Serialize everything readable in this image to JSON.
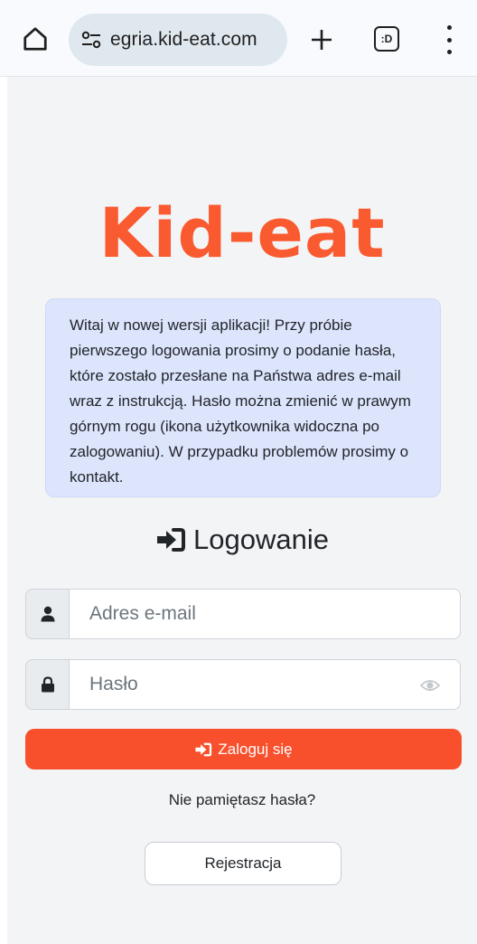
{
  "browser": {
    "url": "egria.kid-eat.com",
    "tabs_label": ":D"
  },
  "logo": {
    "text": "Kid-eat"
  },
  "info": {
    "message": "Witaj w nowej wersji aplikacji! Przy próbie pierwszego logowania prosimy o podanie hasła, które zostało przesłane na Państwa adres e-mail wraz z instrukcją. Hasło można zmienić w prawym górnym rogu (ikona użytkownika widoczna po zalogowaniu). W przypadku problemów prosimy o kontakt."
  },
  "login": {
    "heading": "Logowanie",
    "email_placeholder": "Adres e-mail",
    "password_placeholder": "Hasło",
    "submit_label": "Zaloguj się",
    "forgot_label": "Nie pamiętasz hasła?",
    "register_label": "Rejestracja"
  },
  "icons": {
    "home": "home-icon",
    "site_info": "tune-icon",
    "new_tab": "plus-icon",
    "menu": "more-vert-icon",
    "login": "sign-in-icon",
    "user": "user-icon",
    "lock": "lock-icon",
    "eye": "eye-icon"
  },
  "colors": {
    "brand": "#fa5a2f",
    "button": "#f8502c",
    "info_bg": "#dde5fd",
    "page_bg": "#f3f4f6"
  }
}
